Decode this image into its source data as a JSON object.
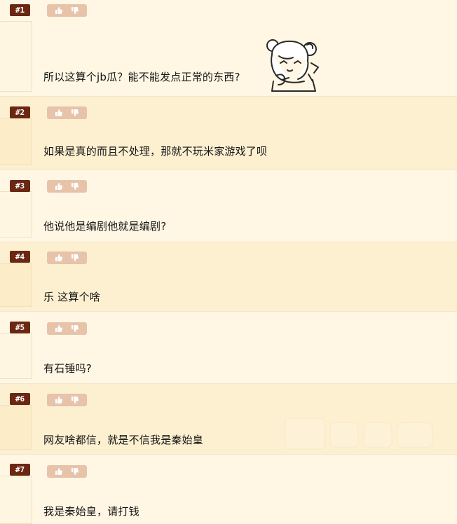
{
  "thread": {
    "posts": [
      {
        "floor": "#1",
        "text": "所以这算个jb瓜？能不能发点正常的东西?",
        "has_sticker": true
      },
      {
        "floor": "#2",
        "text": "如果是真的而且不处理，那就不玩米家游戏了呗"
      },
      {
        "floor": "#3",
        "text": "他说他是编剧他就是编剧?"
      },
      {
        "floor": "#4",
        "text": "乐 这算个啥"
      },
      {
        "floor": "#5",
        "text": "有石锤吗?"
      },
      {
        "floor": "#6",
        "text": "网友啥都信，就是不信我是秦始皇"
      },
      {
        "floor": "#7",
        "text": "我是秦始皇，请打钱"
      }
    ]
  },
  "icons": {
    "upvote": "thumb-up-icon",
    "downvote": "thumb-down-icon",
    "sticker": "anime-girl-sticker",
    "watermark": "site-watermark-logo"
  },
  "colors": {
    "page_bg": "#fff7e4",
    "alt_bg": "#fdf0d0",
    "floor_badge": "#6b2712",
    "vote_bg": "#e7c3aa",
    "text": "#151515"
  }
}
